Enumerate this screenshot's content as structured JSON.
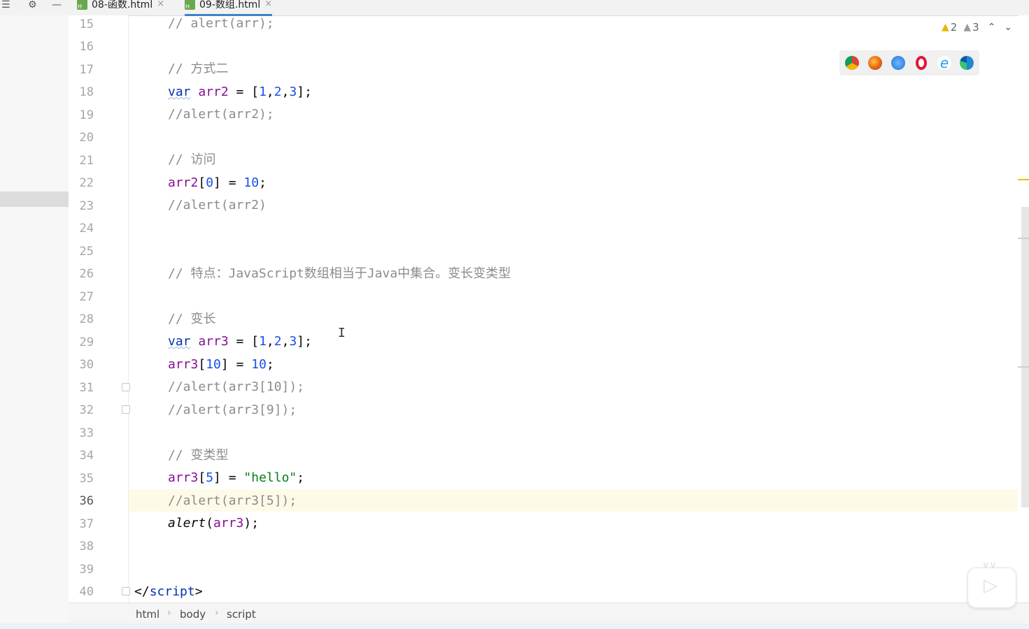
{
  "tabs": [
    {
      "label": "08-函数.html",
      "active": false
    },
    {
      "label": "09-数组.html",
      "active": true
    }
  ],
  "inspections": {
    "warnings": "2",
    "weak_warnings": "3"
  },
  "line_numbers": [
    "15",
    "16",
    "17",
    "18",
    "19",
    "20",
    "21",
    "22",
    "23",
    "24",
    "25",
    "26",
    "27",
    "28",
    "29",
    "30",
    "31",
    "32",
    "33",
    "34",
    "35",
    "36",
    "37",
    "38",
    "39",
    "40"
  ],
  "current_line": "36",
  "code": {
    "l15": "// alert(arr);",
    "l17": "// 方式二",
    "l18_kw": "var",
    "l18_var": "arr2",
    "l18_a": " = [",
    "l18_n1": "1",
    "l18_n2": "2",
    "l18_n3": "3",
    "l18_end": "];",
    "l19": "//alert(arr2);",
    "l21": "// 访问",
    "l22_var": "arr2",
    "l22_n": "0",
    "l22_v": "10",
    "l23": "//alert(arr2)",
    "l26": "// 特点：JavaScript数组相当于Java中集合。变长变类型",
    "l28": "// 变长",
    "l29_kw": "var",
    "l29_var": "arr3",
    "l29_n1": "1",
    "l29_n2": "2",
    "l29_n3": "3",
    "l30_var": "arr3",
    "l30_i": "10",
    "l30_v": "10",
    "l31": "//alert(arr3[10]);",
    "l32": "//alert(arr3[9]);",
    "l34": "// 变类型",
    "l35_var": "arr3",
    "l35_i": "5",
    "l35_s": "\"hello\"",
    "l36": "//alert(arr3[5]);",
    "l37_fn": "alert",
    "l37_var": "arr3",
    "l40_open": "</",
    "l40_tag": "script",
    "l40_close": ">"
  },
  "breadcrumb": [
    "html",
    "body",
    "script"
  ],
  "browsers": [
    "chrome-icon",
    "firefox-icon",
    "safari-icon",
    "opera-icon",
    "ie-icon",
    "edge-icon"
  ],
  "colors": {
    "keyword": "#0033b3",
    "variable": "#871094",
    "number": "#1750eb",
    "string": "#067d17",
    "comment": "#8c8c8c",
    "warning": "#e5b800"
  }
}
